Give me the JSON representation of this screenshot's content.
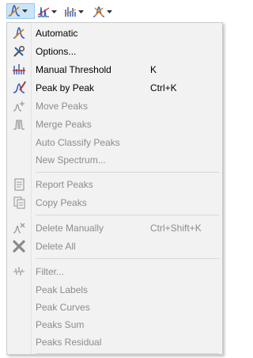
{
  "toolbar": {
    "buttons": [
      {
        "icon": "peak-fit-icon",
        "active": true
      },
      {
        "icon": "peak-line-icon",
        "active": false
      },
      {
        "icon": "peak-bars-icon",
        "active": false
      },
      {
        "icon": "peak-star-icon",
        "active": false
      }
    ]
  },
  "menu": {
    "items": [
      {
        "label": "Automatic",
        "shortcut": "",
        "enabled": true,
        "icon": "automatic-peaks-icon"
      },
      {
        "label": "Options...",
        "shortcut": "",
        "enabled": true,
        "icon": "tools-icon"
      },
      {
        "label": "Manual Threshold",
        "shortcut": "K",
        "enabled": true,
        "icon": "threshold-icon"
      },
      {
        "label": "Peak by Peak",
        "shortcut": "Ctrl+K",
        "enabled": true,
        "icon": "peak-by-peak-icon"
      },
      {
        "label": "Move Peaks",
        "shortcut": "",
        "enabled": false,
        "icon": "move-peaks-icon"
      },
      {
        "label": "Merge Peaks",
        "shortcut": "",
        "enabled": false,
        "icon": "merge-peaks-icon"
      },
      {
        "label": "Auto Classify Peaks",
        "shortcut": "",
        "enabled": false,
        "icon": ""
      },
      {
        "label": "New Spectrum...",
        "shortcut": "",
        "enabled": false,
        "icon": ""
      },
      {
        "label": "Report Peaks",
        "shortcut": "",
        "enabled": false,
        "icon": "report-icon"
      },
      {
        "label": "Copy Peaks",
        "shortcut": "",
        "enabled": false,
        "icon": "copy-icon"
      },
      {
        "label": "Delete Manually",
        "shortcut": "Ctrl+Shift+K",
        "enabled": false,
        "icon": "delete-manually-icon"
      },
      {
        "label": "Delete All",
        "shortcut": "",
        "enabled": false,
        "icon": "delete-all-icon"
      },
      {
        "label": "Filter...",
        "shortcut": "",
        "enabled": false,
        "icon": "filter-icon"
      },
      {
        "label": "Peak Labels",
        "shortcut": "",
        "enabled": false,
        "icon": ""
      },
      {
        "label": "Peak Curves",
        "shortcut": "",
        "enabled": false,
        "icon": ""
      },
      {
        "label": "Peaks Sum",
        "shortcut": "",
        "enabled": false,
        "icon": ""
      },
      {
        "label": "Peaks Residual",
        "shortcut": "",
        "enabled": false,
        "icon": ""
      }
    ]
  },
  "colors": {
    "menu_bg": "#f2f2f2",
    "disabled_text": "#8c8c8c",
    "active_button_bg": "#cce4f7",
    "peak_blue": "#2a5db0",
    "peak_orange": "#e07a1a",
    "peak_red": "#c62828"
  }
}
